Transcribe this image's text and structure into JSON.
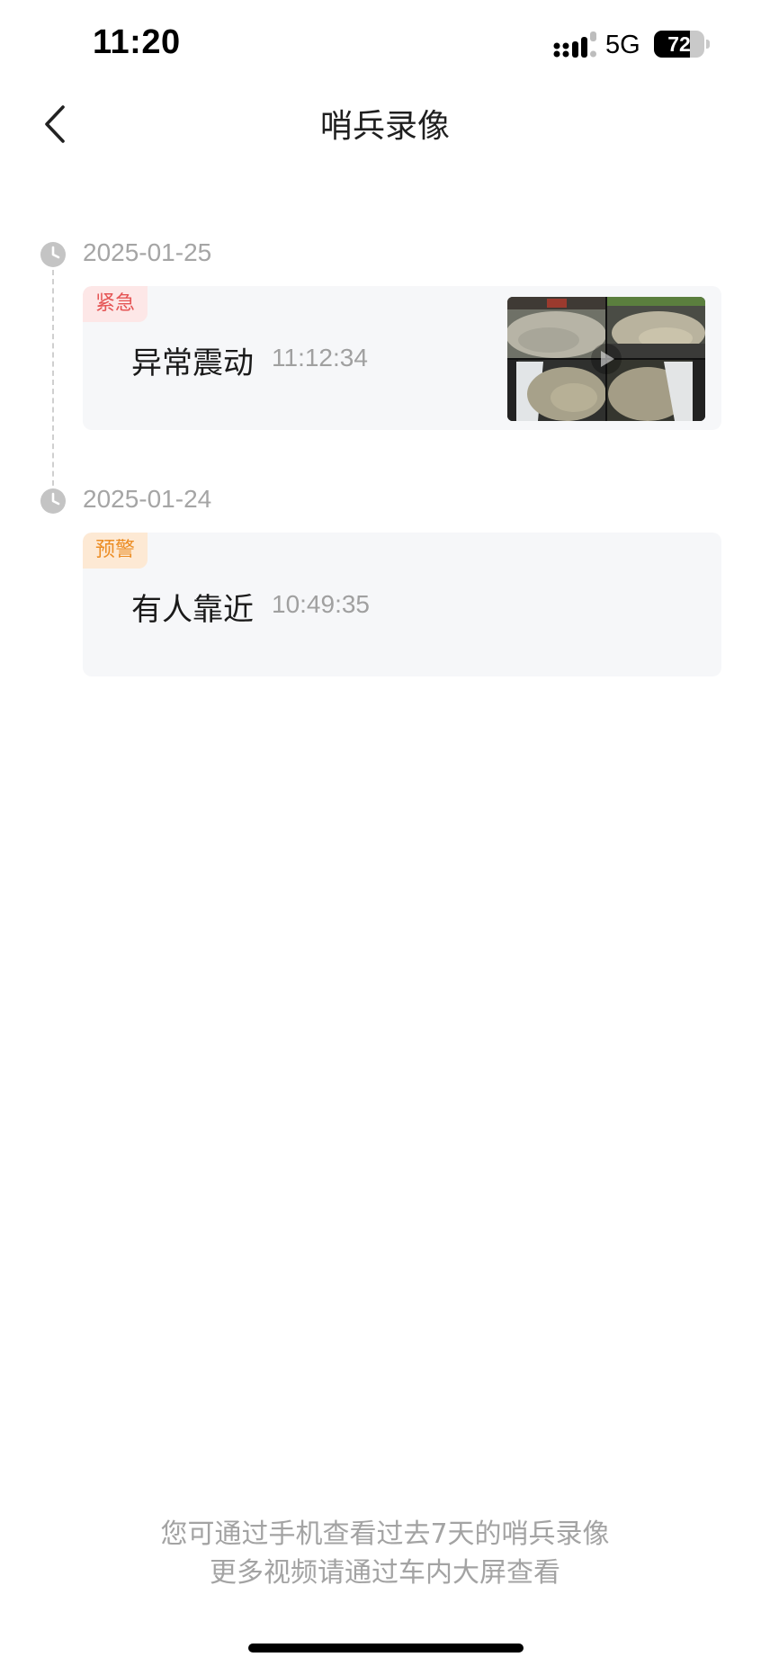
{
  "status_bar": {
    "time": "11:20",
    "network": "5G",
    "battery_level": "72",
    "battery_fraction": 0.72
  },
  "nav": {
    "back_icon": "chevron-left-icon",
    "title": "哨兵录像"
  },
  "timeline": [
    {
      "date": "2025-01-25",
      "events": [
        {
          "badge": "紧急",
          "badge_type": "urgent",
          "name": "异常震动",
          "time": "11:12:34",
          "has_thumbnail": true
        }
      ]
    },
    {
      "date": "2025-01-24",
      "events": [
        {
          "badge": "预警",
          "badge_type": "warning",
          "name": "有人靠近",
          "time": "10:49:35",
          "has_thumbnail": false
        }
      ]
    }
  ],
  "footer": {
    "line1": "您可通过手机查看过去7天的哨兵录像",
    "line2": "更多视频请通过车内大屏查看"
  },
  "colors": {
    "urgent_text": "#e55454",
    "urgent_bg": "#fde7e7",
    "warning_text": "#ec8d24",
    "warning_bg": "#fde9d4",
    "card_bg": "#f6f7f9",
    "muted_text": "#a5a5a5"
  }
}
